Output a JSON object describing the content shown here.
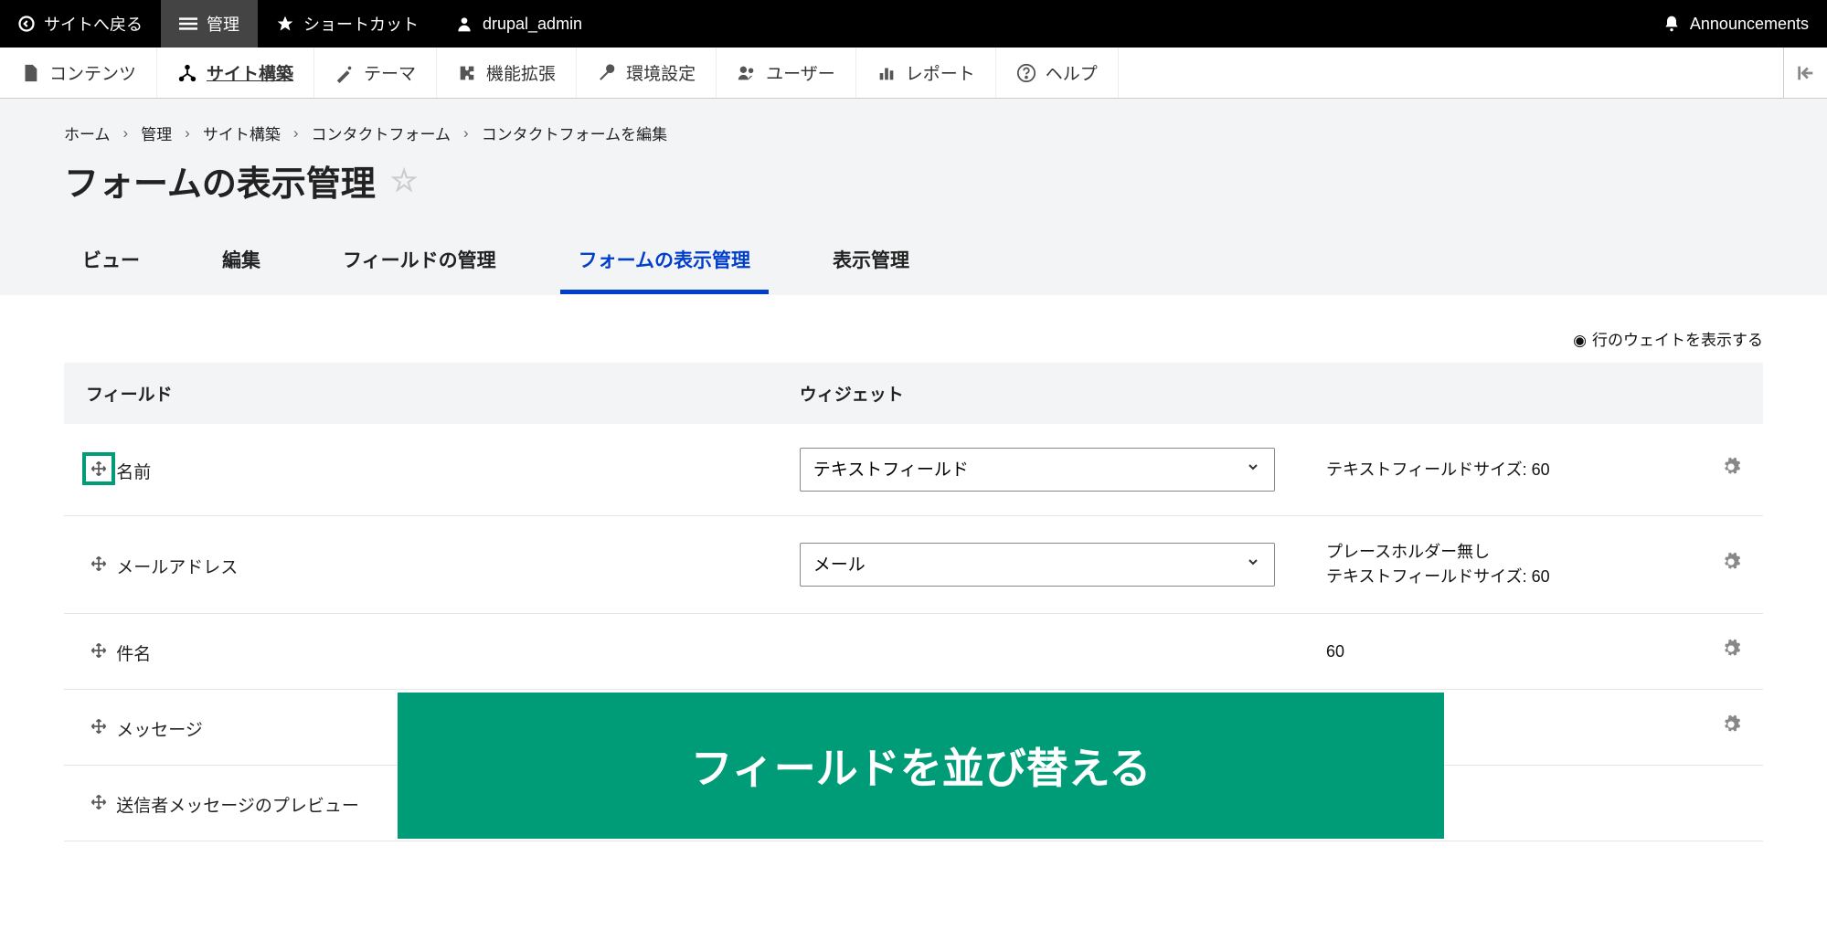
{
  "topbar": {
    "back": "サイトへ戻る",
    "manage": "管理",
    "shortcuts": "ショートカット",
    "user": "drupal_admin",
    "announcements": "Announcements"
  },
  "adminbar": {
    "content": "コンテンツ",
    "structure": "サイト構築",
    "appearance": "テーマ",
    "extend": "機能拡張",
    "config": "環境設定",
    "people": "ユーザー",
    "reports": "レポート",
    "help": "ヘルプ"
  },
  "breadcrumb": [
    "ホーム",
    "管理",
    "サイト構築",
    "コンタクトフォーム",
    "コンタクトフォームを編集"
  ],
  "page_title": "フォームの表示管理",
  "tabs": {
    "view": "ビュー",
    "edit": "編集",
    "fields": "フィールドの管理",
    "form_display": "フォームの表示管理",
    "display": "表示管理"
  },
  "show_weights": "行のウェイトを表示する",
  "table": {
    "col_field": "フィールド",
    "col_widget": "ウィジェット",
    "rows": [
      {
        "label": "名前",
        "widget": "テキストフィールド",
        "summary": "テキストフィールドサイズ: 60",
        "hl": true,
        "gear": true
      },
      {
        "label": "メールアドレス",
        "widget": "メール",
        "summary": "プレースホルダー無し\nテキストフィールドサイズ: 60",
        "gear": true
      },
      {
        "label": "件名",
        "widget": "",
        "summary": "60",
        "gear": true
      },
      {
        "label": "メッセージ",
        "widget": "",
        "summary": "",
        "gear": true
      },
      {
        "label": "送信者メッセージのプレビュー",
        "widget": "",
        "summary": "",
        "gear": false
      }
    ]
  },
  "overlay": "フィールドを並び替える"
}
